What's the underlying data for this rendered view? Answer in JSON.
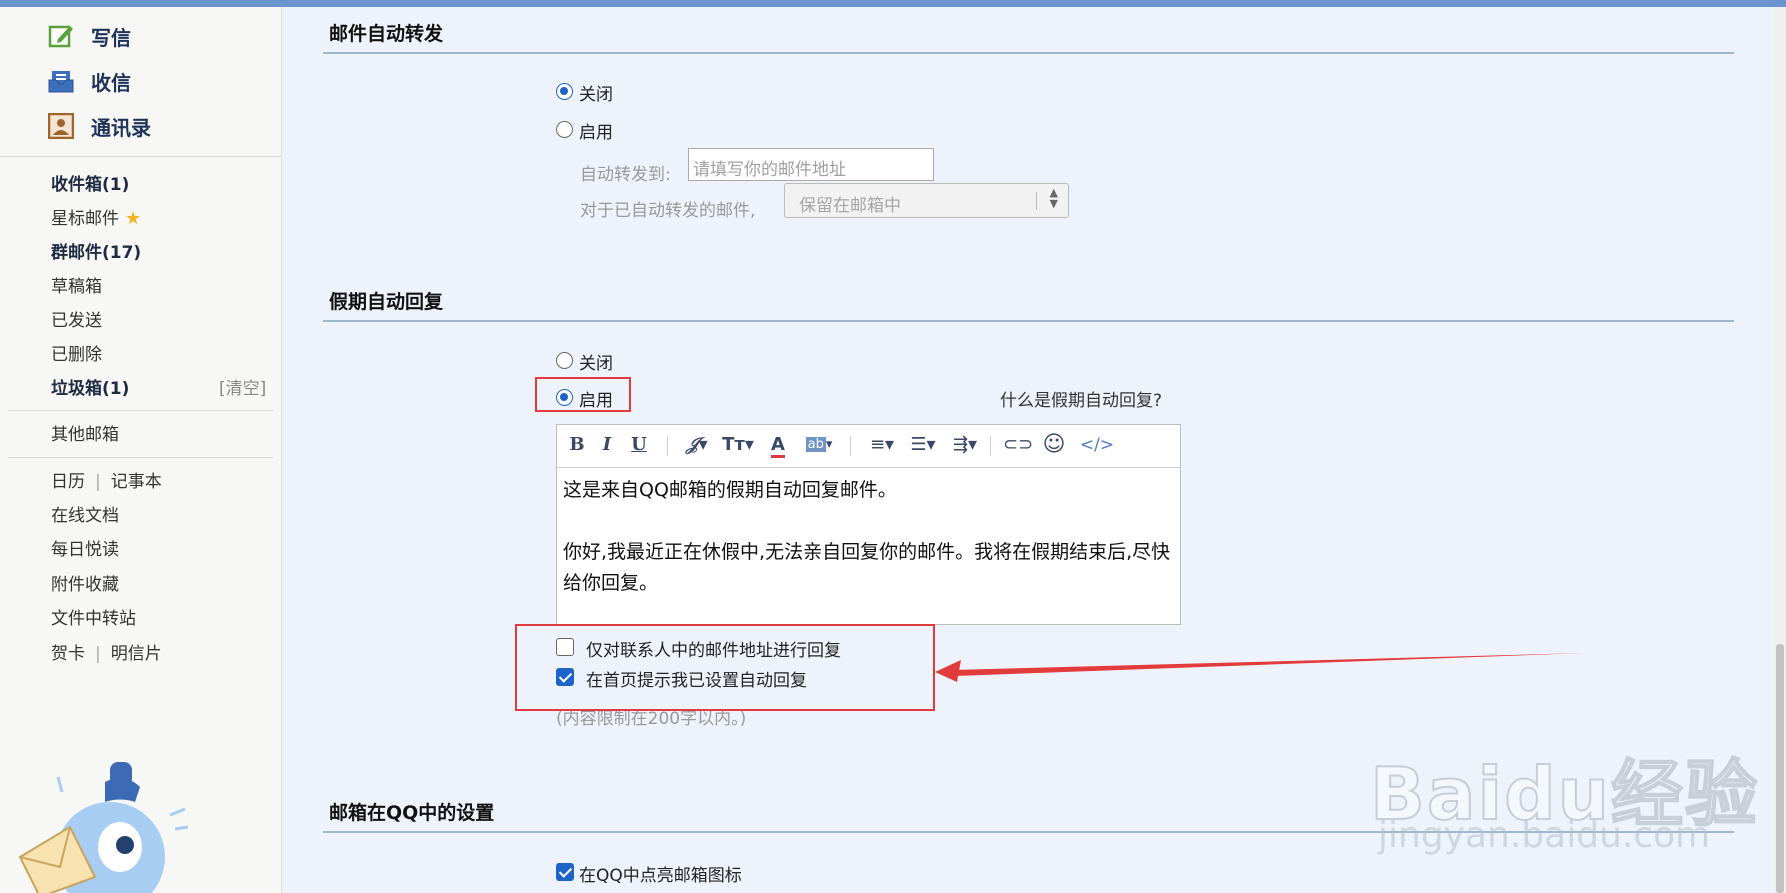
{
  "quick_actions": [
    {
      "label": "写信",
      "icon": "compose-icon"
    },
    {
      "label": "收信",
      "icon": "inbox-tray-icon"
    },
    {
      "label": "通讯录",
      "icon": "contacts-icon"
    }
  ],
  "folders": {
    "inbox": "收件箱(1)",
    "starred": "星标邮件",
    "group": "群邮件(17)",
    "drafts": "草稿箱",
    "sent": "已发送",
    "deleted": "已删除",
    "spam": "垃圾箱(1)",
    "spam_clear": "[清空]",
    "other": "其他邮箱"
  },
  "tools": {
    "calendar": "日历",
    "notepad": "记事本",
    "docs": "在线文档",
    "reading": "每日悦读",
    "attachments": "附件收藏",
    "transfer": "文件中转站",
    "cards": "贺卡",
    "postcards": "明信片"
  },
  "forwarding": {
    "title": "邮件自动转发",
    "off_label": "关闭",
    "on_label": "启用",
    "selected": "off",
    "forward_to_label": "自动转发到:",
    "forward_to_placeholder": "请填写你的邮件地址",
    "after_label": "对于已自动转发的邮件,",
    "after_value": "保留在邮箱中"
  },
  "vacation": {
    "title": "假期自动回复",
    "off_label": "关闭",
    "on_label": "启用",
    "selected": "on",
    "help_link": "什么是假期自动回复?",
    "message_line1": "这是来自QQ邮箱的假期自动回复邮件。",
    "message_line2": "你好,我最近正在休假中,无法亲自回复你的邮件。我将在假期结束后,尽快给你回复。",
    "contacts_only_label": "仅对联系人中的邮件地址进行回复",
    "contacts_only_checked": false,
    "homepage_notice_label": "在首页提示我已设置自动回复",
    "homepage_notice_checked": true,
    "limit_note": "(内容限制在200字以内。)"
  },
  "qq_settings": {
    "title": "邮箱在QQ中的设置",
    "light_icon_label": "在QQ中点亮邮箱图标",
    "light_icon_checked": true
  },
  "watermark": {
    "logo": "Baidu经验",
    "url": "jingyan.baidu.com"
  },
  "colors": {
    "accent": "#1e63c8",
    "highlight": "#e23b3b",
    "section_line": "#9fb6cf"
  }
}
